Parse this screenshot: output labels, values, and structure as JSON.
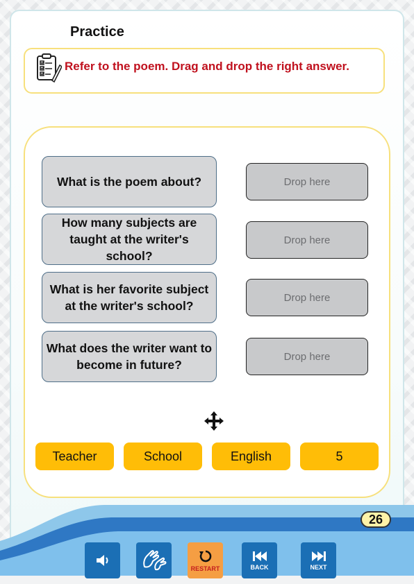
{
  "header": {
    "title": "Practice"
  },
  "instruction": {
    "icon": "clipboard-checklist-icon",
    "text": "Refer to the poem. Drag and drop the right answer."
  },
  "questions": [
    {
      "text": "What is the poem about?",
      "drop": "Drop here"
    },
    {
      "text": "How many subjects are taught at the writer's school?",
      "drop": "Drop here"
    },
    {
      "text": "What is her favorite subject at the writer's school?",
      "drop": "Drop here"
    },
    {
      "text": "What does the writer want to become in future?",
      "drop": "Drop here"
    }
  ],
  "move_icon": "move-arrows-icon",
  "options": [
    "Teacher",
    "School",
    "English",
    "5"
  ],
  "page_number": "26",
  "nav": {
    "audio": {
      "icon": "speaker-icon",
      "label": ""
    },
    "sign_language": {
      "icon": "sign-language-icon",
      "label": ""
    },
    "restart": {
      "icon": "restart-icon",
      "label": "RESTART"
    },
    "back": {
      "icon": "skip-back-icon",
      "label": "BACK"
    },
    "next": {
      "icon": "skip-next-icon",
      "label": "NEXT"
    }
  },
  "colors": {
    "instruction_text": "#c0111e",
    "option_bg": "#ffbd07",
    "frame_border": "#f7e07c",
    "nav_blue": "#1b6fb5",
    "restart_bg": "#f59e43"
  }
}
